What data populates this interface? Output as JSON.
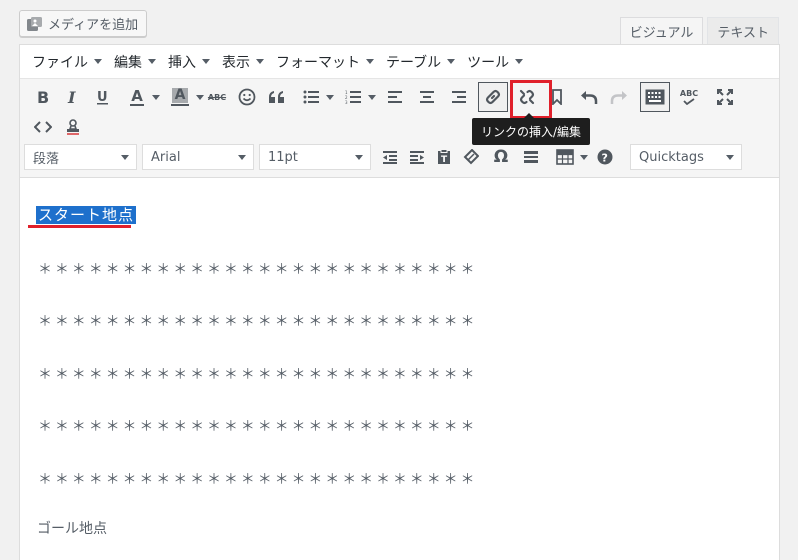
{
  "media_button": {
    "label": "メディアを追加",
    "icon": "media-icon"
  },
  "tabs": [
    {
      "label": "ビジュアル",
      "active": true
    },
    {
      "label": "テキスト",
      "active": false
    }
  ],
  "menubar": [
    {
      "label": "ファイル"
    },
    {
      "label": "編集"
    },
    {
      "label": "挿入"
    },
    {
      "label": "表示"
    },
    {
      "label": "フォーマット"
    },
    {
      "label": "テーブル"
    },
    {
      "label": "ツール"
    }
  ],
  "toolbar": {
    "text_color_letter": "A",
    "bg_color_letter": "A",
    "strikethrough_text": "ABC",
    "spellcheck_text": "ABC",
    "format_select": "段落",
    "font_select": "Arial",
    "size_select": "11pt",
    "omega_symbol": "Ω",
    "quicktags_select": "Quicktags"
  },
  "tooltip": {
    "text": "リンクの挿入/編集"
  },
  "content": {
    "start_text": "スタート地点",
    "star_lines": [
      "＊＊＊＊＊＊＊＊＊＊＊＊＊＊＊＊＊＊＊＊＊＊＊＊＊＊",
      "＊＊＊＊＊＊＊＊＊＊＊＊＊＊＊＊＊＊＊＊＊＊＊＊＊＊",
      "＊＊＊＊＊＊＊＊＊＊＊＊＊＊＊＊＊＊＊＊＊＊＊＊＊＊",
      "＊＊＊＊＊＊＊＊＊＊＊＊＊＊＊＊＊＊＊＊＊＊＊＊＊＊",
      "＊＊＊＊＊＊＊＊＊＊＊＊＊＊＊＊＊＊＊＊＊＊＊＊＊＊"
    ],
    "goal_text": "ゴール地点"
  },
  "colors": {
    "selection": "#1e70cc",
    "highlight": "#e0202b",
    "tooltip_bg": "#1e1e1e"
  }
}
